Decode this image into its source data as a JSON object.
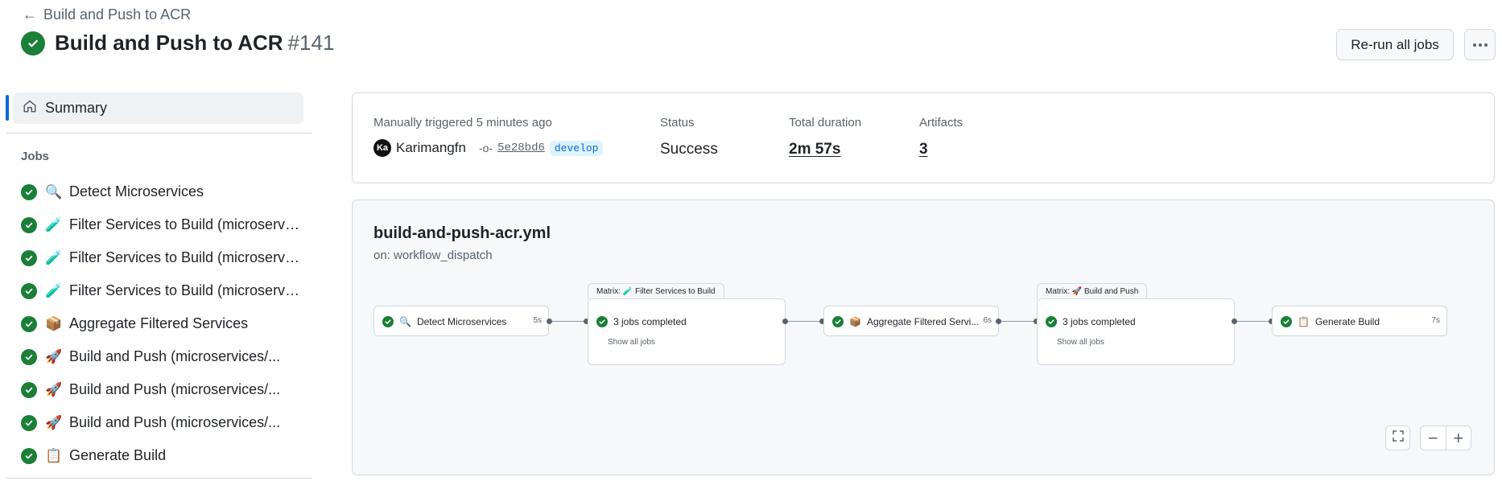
{
  "header": {
    "back_label": "Build and Push to ACR",
    "title": "Build and Push to ACR",
    "run_number": "#141",
    "rerun_label": "Re-run all jobs"
  },
  "sidebar": {
    "summary_label": "Summary",
    "jobs_heading": "Jobs",
    "jobs": [
      {
        "emoji": "🔍",
        "label": "Detect Microservices"
      },
      {
        "emoji": "🧪",
        "label": "Filter Services to Build (microservices/..."
      },
      {
        "emoji": "🧪",
        "label": "Filter Services to Build (microservices/..."
      },
      {
        "emoji": "🧪",
        "label": "Filter Services to Build (microservices/..."
      },
      {
        "emoji": "📦",
        "label": "Aggregate Filtered Services"
      },
      {
        "emoji": "🚀",
        "label": "Build and Push (microservices/..."
      },
      {
        "emoji": "🚀",
        "label": "Build and Push (microservices/..."
      },
      {
        "emoji": "🚀",
        "label": "Build and Push (microservices/..."
      },
      {
        "emoji": "📋",
        "label": "Generate Build"
      }
    ]
  },
  "summary_card": {
    "trigger_label": "Manually triggered 5 minutes ago",
    "avatar_initials": "Ka",
    "user": "Karimangfn",
    "commit_sha": "5e28bd6",
    "branch": "develop",
    "status_label": "Status",
    "status_value": "Success",
    "duration_label": "Total duration",
    "duration_value": "2m 57s",
    "artifacts_label": "Artifacts",
    "artifacts_value": "3"
  },
  "graph": {
    "workflow_file": "build-and-push-acr.yml",
    "trigger": "on: workflow_dispatch",
    "nodes": {
      "detect": {
        "emoji": "🔍",
        "label": "Detect Microservices",
        "duration": "5s"
      },
      "filter_matrix": {
        "tab": "Matrix: 🧪 Filter Services to Build",
        "label": "3 jobs completed",
        "sub": "Show all jobs"
      },
      "aggregate": {
        "emoji": "📦",
        "label": "Aggregate Filtered Servi...",
        "duration": "6s"
      },
      "build_matrix": {
        "tab": "Matrix: 🚀 Build and Push",
        "label": "3 jobs completed",
        "sub": "Show all jobs"
      },
      "generate": {
        "emoji": "📋",
        "label": "Generate Build",
        "duration": "7s"
      }
    },
    "zoom": {
      "fullscreen_icon": "fullscreen-icon",
      "zoom_out": "−",
      "zoom_in": "+"
    }
  },
  "colors": {
    "success": "#1a7f37",
    "accent": "#0969da",
    "muted_text": "#59636e",
    "border": "#d1d9e0"
  }
}
